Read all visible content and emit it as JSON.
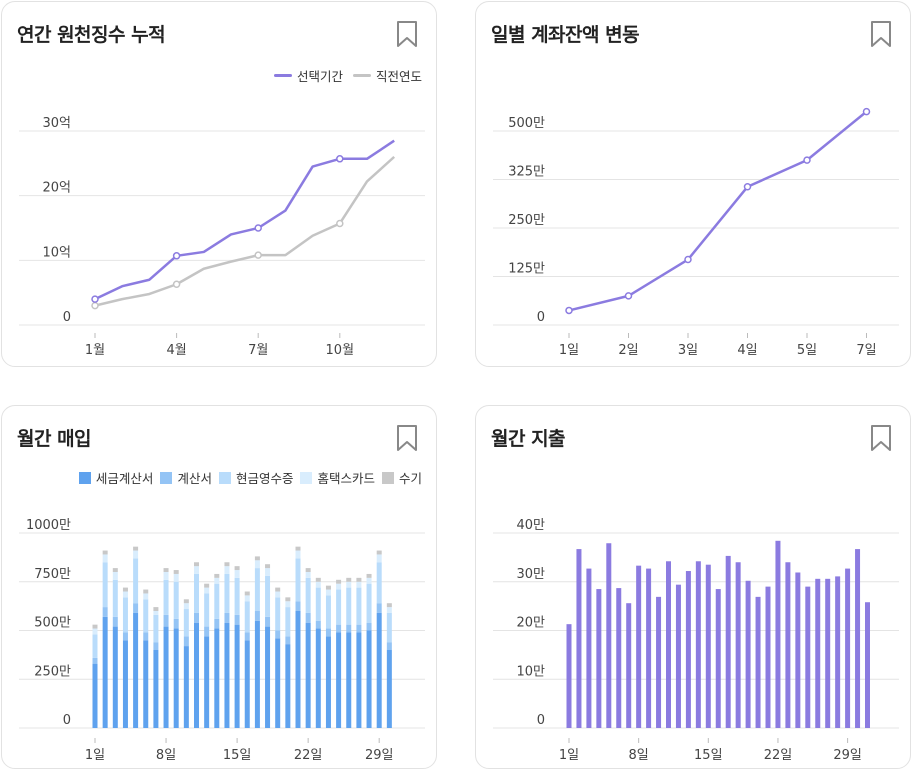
{
  "charts": {
    "annual": {
      "title": "연간 원천징수 누적",
      "chart_data": {
        "type": "line",
        "title": "연간 원천징수 누적",
        "x": [
          1,
          2,
          3,
          4,
          5,
          6,
          7,
          8,
          9,
          10,
          11,
          12
        ],
        "xticks": [
          "1월",
          "4월",
          "7월",
          "10월"
        ],
        "xtick_positions": [
          1,
          4,
          7,
          10
        ],
        "yticks": [
          "0",
          "10억",
          "20억",
          "30억"
        ],
        "ylim": [
          0,
          30
        ],
        "series": [
          {
            "name": "선택기간",
            "color": "#8b7be0",
            "values": [
              4,
              6,
              7,
              10.7,
              11.3,
              14,
              15,
              17.7,
              24.5,
              25.7,
              25.7,
              28.5
            ],
            "markers": [
              1,
              4,
              7,
              10
            ]
          },
          {
            "name": "직전연도",
            "color": "#c4c4c4",
            "values": [
              3,
              4,
              4.8,
              6.3,
              8.7,
              9.8,
              10.8,
              10.8,
              13.8,
              15.7,
              22.2,
              26
            ],
            "markers": [
              1,
              4,
              7,
              10
            ]
          }
        ],
        "legend_position": "top-right",
        "grid": true
      }
    },
    "daily": {
      "title": "일별 계좌잔액 변동",
      "chart_data": {
        "type": "line",
        "title": "일별 계좌잔액 변동",
        "categories": [
          "1일",
          "2일",
          "3일",
          "4일",
          "5일",
          "7일"
        ],
        "yticks": [
          "0",
          "125만",
          "250만",
          "325만",
          "500만"
        ],
        "values": [
          0.3,
          0.6,
          1.35,
          2.85,
          3.4,
          4.4
        ],
        "series_color": "#8b7be0",
        "grid": true
      }
    },
    "purchase": {
      "title": "월간 매입",
      "chart_data": {
        "type": "bar",
        "stacked": true,
        "title": "월간 매입",
        "x": [
          1,
          2,
          3,
          4,
          5,
          6,
          7,
          8,
          9,
          10,
          11,
          12,
          13,
          14,
          15,
          16,
          17,
          18,
          19,
          20,
          21,
          22,
          23,
          24,
          25,
          26,
          27,
          28,
          29,
          30
        ],
        "xticks": [
          "1일",
          "8일",
          "15일",
          "22일",
          "29일"
        ],
        "xtick_positions": [
          1,
          8,
          15,
          22,
          29
        ],
        "yticks": [
          "0",
          "250만",
          "500만",
          "750만",
          "1000만"
        ],
        "ylim": [
          0,
          1000
        ],
        "series": [
          {
            "name": "세금계산서",
            "color": "#5fa2ee",
            "values": [
              330,
              570,
              520,
              450,
              590,
              450,
              400,
              520,
              510,
              420,
              540,
              470,
              510,
              540,
              530,
              450,
              550,
              520,
              460,
              430,
              600,
              540,
              510,
              470,
              490,
              490,
              490,
              500,
              590,
              400
            ]
          },
          {
            "name": "계산서",
            "color": "#94c4f5",
            "values": [
              30,
              50,
              50,
              40,
              50,
              40,
              40,
              60,
              50,
              50,
              50,
              50,
              50,
              50,
              50,
              40,
              50,
              50,
              40,
              40,
              50,
              50,
              40,
              40,
              40,
              40,
              40,
              40,
              50,
              40
            ]
          },
          {
            "name": "현금영수증",
            "color": "#b9dcfb",
            "values": [
              120,
              230,
              190,
              180,
              230,
              170,
              140,
              180,
              190,
              140,
              200,
              170,
              180,
              200,
              190,
              160,
              220,
              210,
              170,
              150,
              220,
              180,
              170,
              170,
              180,
              190,
              190,
              200,
              210,
              150
            ]
          },
          {
            "name": "홈택스카드",
            "color": "#d9edfd",
            "values": [
              30,
              40,
              40,
              30,
              40,
              30,
              20,
              40,
              40,
              30,
              40,
              30,
              30,
              40,
              40,
              30,
              40,
              40,
              30,
              30,
              40,
              30,
              30,
              30,
              30,
              30,
              30,
              30,
              40,
              30
            ]
          },
          {
            "name": "수기",
            "color": "#c8c8c8",
            "values": [
              20,
              20,
              20,
              20,
              20,
              20,
              20,
              20,
              20,
              20,
              20,
              20,
              20,
              20,
              20,
              20,
              20,
              20,
              20,
              20,
              20,
              20,
              20,
              20,
              20,
              20,
              20,
              20,
              20,
              20
            ]
          }
        ],
        "legend_position": "top-right",
        "grid": true
      }
    },
    "expense": {
      "title": "월간 지출",
      "chart_data": {
        "type": "bar",
        "title": "월간 지출",
        "x": [
          1,
          2,
          3,
          4,
          5,
          6,
          7,
          8,
          9,
          10,
          11,
          12,
          13,
          14,
          15,
          16,
          17,
          18,
          19,
          20,
          21,
          22,
          23,
          24,
          25,
          26,
          27,
          28,
          29,
          30
        ],
        "xticks": [
          "1일",
          "8일",
          "15일",
          "22일",
          "29일"
        ],
        "xtick_positions": [
          1,
          8,
          15,
          22,
          29
        ],
        "yticks": [
          "0",
          "10만",
          "20만",
          "30만",
          "40만"
        ],
        "ylim": [
          0,
          40
        ],
        "values": [
          21.3,
          36.7,
          32.7,
          28.5,
          37.9,
          28.7,
          25.6,
          33.3,
          32.7,
          26.9,
          34.2,
          29.4,
          32.2,
          34.2,
          33.5,
          28.5,
          35.3,
          34.0,
          30.2,
          26.9,
          29.0,
          38.4,
          34.0,
          31.9,
          29.0,
          30.6,
          30.6,
          31.1,
          32.7,
          36.7,
          25.8
        ],
        "color": "#8b7be0",
        "grid": true
      }
    }
  }
}
